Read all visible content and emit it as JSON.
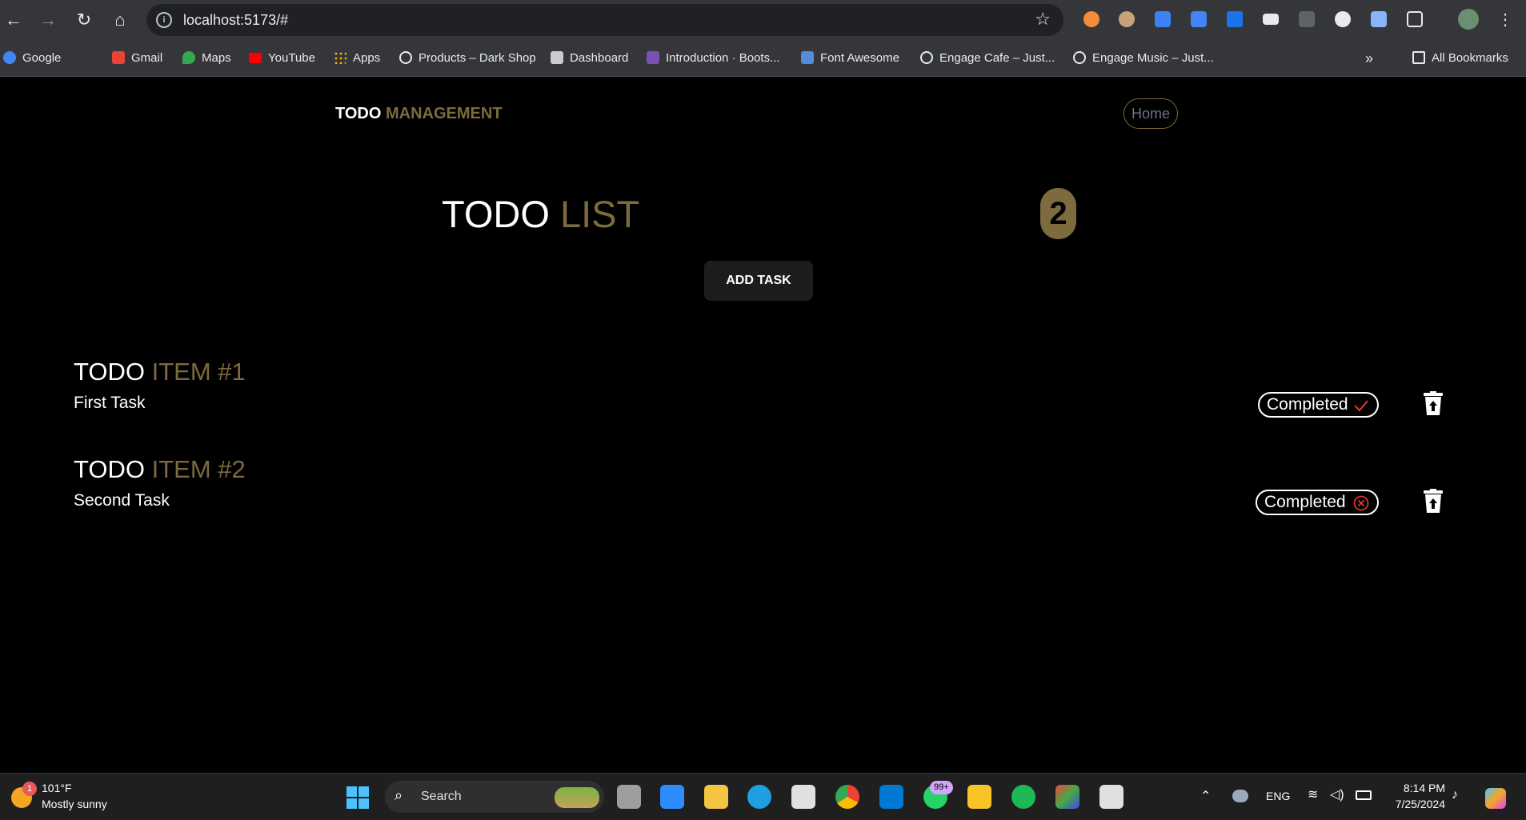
{
  "browser": {
    "url": "localhost:5173/#",
    "bookmarks": [
      {
        "label": "Google",
        "color": "#4285f4"
      },
      {
        "label": "Gmail",
        "color": "#ea4335"
      },
      {
        "label": "Maps",
        "color": "#34a853"
      },
      {
        "label": "YouTube",
        "color": "#ff0000"
      },
      {
        "label": "Apps",
        "color": "#fbbc05"
      },
      {
        "label": "Products – Dark Shop",
        "color": "#e8eaed"
      },
      {
        "label": "Dashboard",
        "color": "#cccccc"
      },
      {
        "label": "Introduction · Boots...",
        "color": "#7952b3"
      },
      {
        "label": "Font Awesome",
        "color": "#538dd7"
      },
      {
        "label": "Engage Cafe – Just...",
        "color": "#e8eaed"
      },
      {
        "label": "Engage Music – Just...",
        "color": "#e8eaed"
      }
    ],
    "all_bookmarks": "All Bookmarks",
    "overflow": "»"
  },
  "app": {
    "brand_primary": "TODO",
    "brand_accent": "MANAGEMENT",
    "nav_home": "Home",
    "title_primary": "TODO",
    "title_accent": "LIST",
    "task_count": "2",
    "add_button": "ADD TASK",
    "accent_color": "#7d6a3d",
    "items": [
      {
        "title_primary": "TODO",
        "title_accent": "ITEM #1",
        "description": "First Task",
        "status_label": "Completed",
        "status_icon": "check-icon",
        "status_color": "#e53935"
      },
      {
        "title_primary": "TODO",
        "title_accent": "ITEM #2",
        "description": "Second Task",
        "status_label": "Completed",
        "status_icon": "x-circle-icon",
        "status_color": "#e53935"
      }
    ]
  },
  "taskbar": {
    "weather_temp": "101°F",
    "weather_desc": "Mostly sunny",
    "weather_badge": "1",
    "search_placeholder": "Search",
    "whatsapp_badge": "99+",
    "language": "ENG",
    "time": "8:14 PM",
    "date": "7/25/2024"
  }
}
